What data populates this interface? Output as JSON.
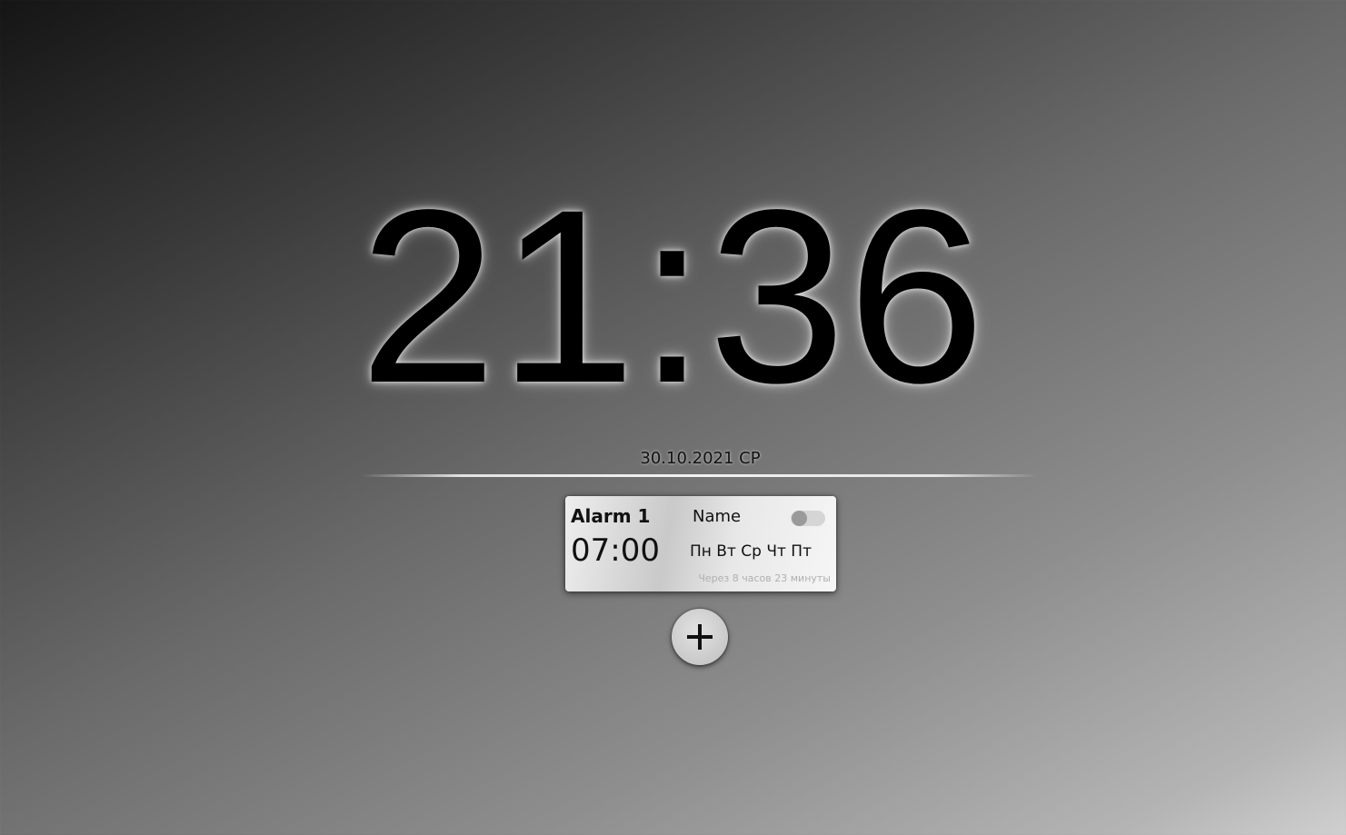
{
  "clock": {
    "time": "21:36"
  },
  "date": {
    "text": "30.10.2021 СР"
  },
  "alarm": {
    "title": "Alarm 1",
    "name": "Name",
    "time": "07:00",
    "days": "Пн Вт Ср Чт Пт",
    "remaining": "Через 8 часов 23 минуты",
    "enabled": false
  },
  "icons": {
    "toggle": "toggle-icon",
    "add": "plus-icon"
  }
}
